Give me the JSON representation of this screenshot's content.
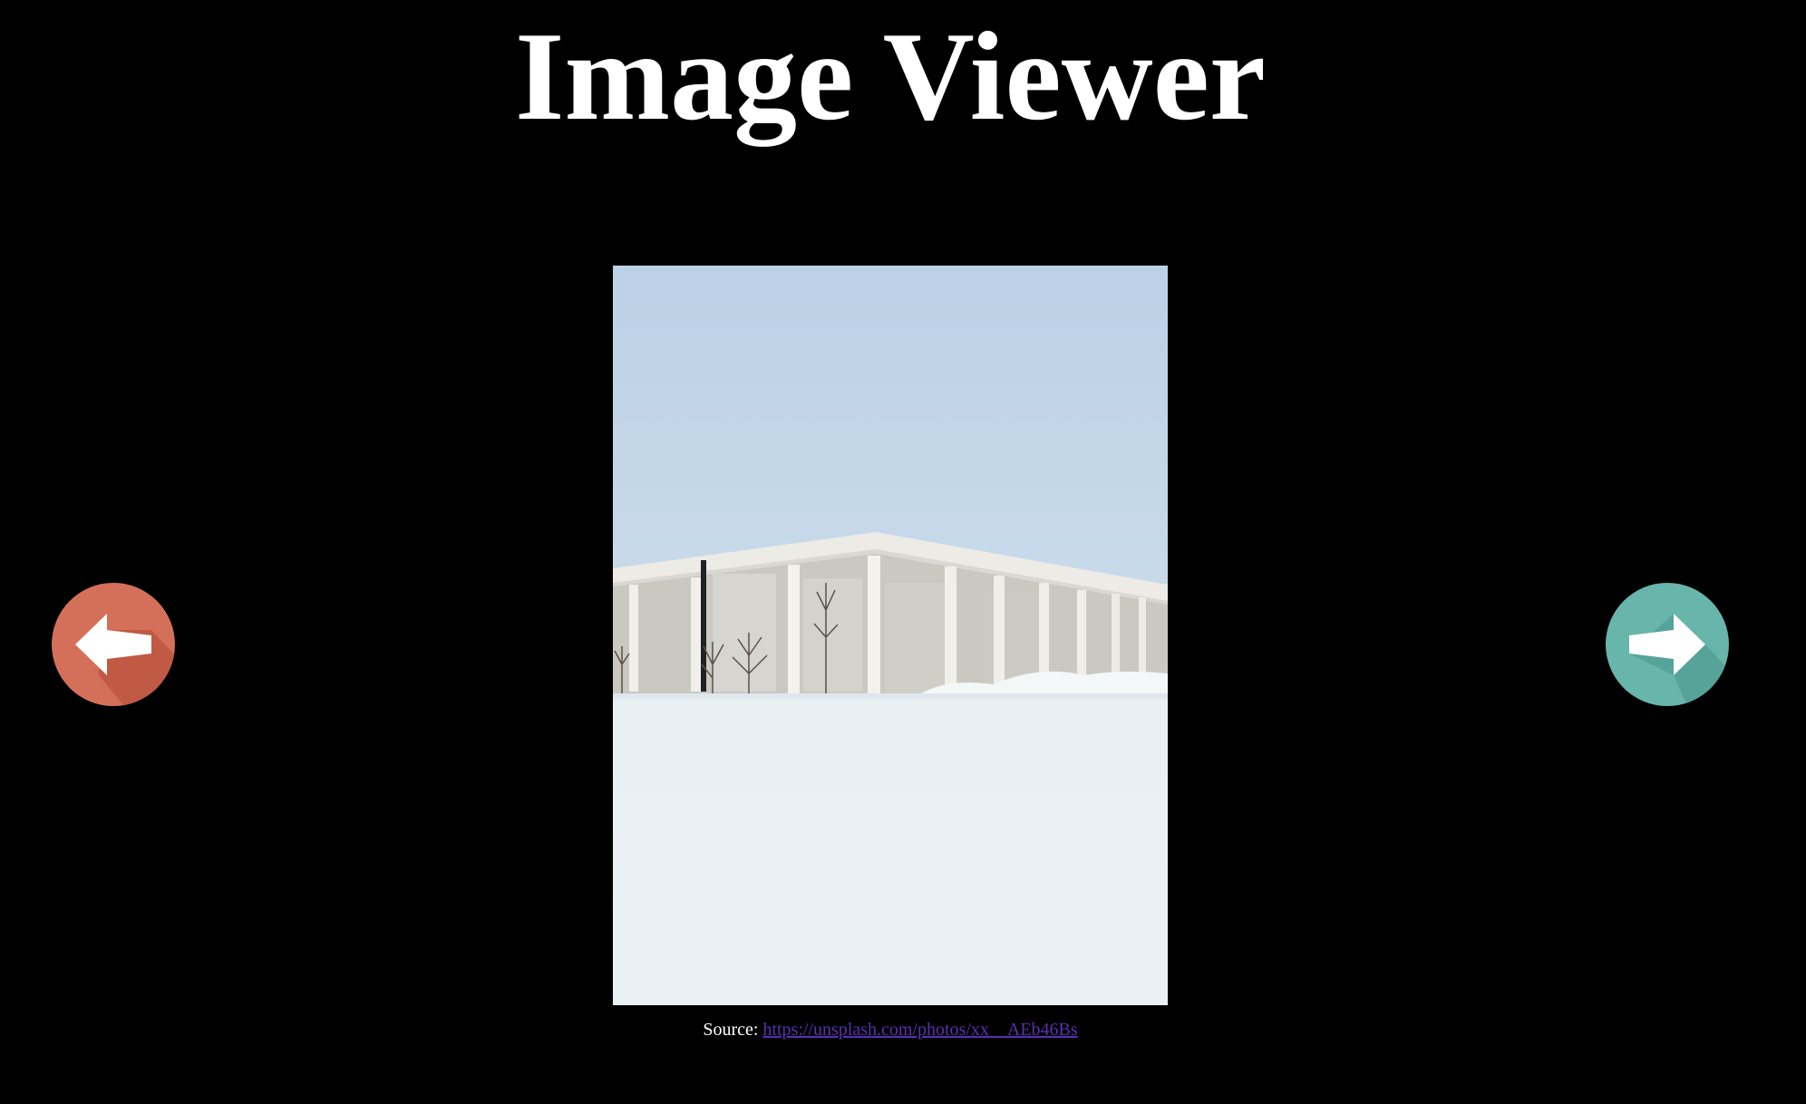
{
  "page": {
    "title": "Image Viewer"
  },
  "image": {
    "subject": "snowy-modern-building-photo"
  },
  "caption": {
    "prefix": "Source:",
    "link_text": "https://unsplash.com/photos/xx__AEb46Bs"
  },
  "nav": {
    "prev_icon": "arrow-left-icon",
    "next_icon": "arrow-right-icon"
  },
  "colors": {
    "background": "#000000",
    "prev_button": "#d4705a",
    "next_button": "#67b5ab",
    "link": "#5a2fb0"
  }
}
